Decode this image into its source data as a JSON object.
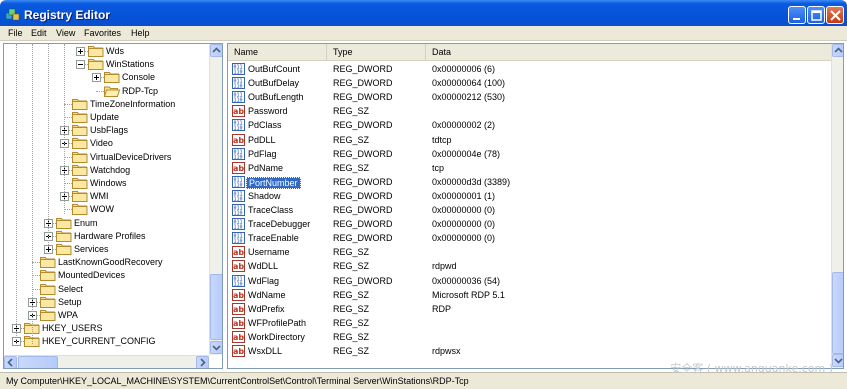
{
  "window": {
    "title": "Registry Editor"
  },
  "menu": [
    "File",
    "Edit",
    "View",
    "Favorites",
    "Help"
  ],
  "tree": [
    {
      "label": "Wds",
      "depth": 5,
      "expander": "plus"
    },
    {
      "label": "WinStations",
      "depth": 5,
      "expander": "minus"
    },
    {
      "label": "Console",
      "depth": 6,
      "expander": "plus"
    },
    {
      "label": "RDP-Tcp",
      "depth": 6,
      "expander": "none",
      "selected": true,
      "open_folder": true
    },
    {
      "label": "TimeZoneInformation",
      "depth": 4,
      "expander": "none"
    },
    {
      "label": "Update",
      "depth": 4,
      "expander": "none"
    },
    {
      "label": "UsbFlags",
      "depth": 4,
      "expander": "plus"
    },
    {
      "label": "Video",
      "depth": 4,
      "expander": "plus"
    },
    {
      "label": "VirtualDeviceDrivers",
      "depth": 4,
      "expander": "none"
    },
    {
      "label": "Watchdog",
      "depth": 4,
      "expander": "plus"
    },
    {
      "label": "Windows",
      "depth": 4,
      "expander": "none"
    },
    {
      "label": "WMI",
      "depth": 4,
      "expander": "plus"
    },
    {
      "label": "WOW",
      "depth": 4,
      "expander": "none"
    },
    {
      "label": "Enum",
      "depth": 3,
      "expander": "plus"
    },
    {
      "label": "Hardware Profiles",
      "depth": 3,
      "expander": "plus"
    },
    {
      "label": "Services",
      "depth": 3,
      "expander": "plus"
    },
    {
      "label": "LastKnownGoodRecovery",
      "depth": 2,
      "expander": "none"
    },
    {
      "label": "MountedDevices",
      "depth": 2,
      "expander": "none"
    },
    {
      "label": "Select",
      "depth": 2,
      "expander": "none"
    },
    {
      "label": "Setup",
      "depth": 2,
      "expander": "plus"
    },
    {
      "label": "WPA",
      "depth": 2,
      "expander": "plus"
    },
    {
      "label": "HKEY_USERS",
      "depth": 1,
      "expander": "plus"
    },
    {
      "label": "HKEY_CURRENT_CONFIG",
      "depth": 1,
      "expander": "plus"
    }
  ],
  "columns": {
    "name": "Name",
    "type": "Type",
    "data": "Data"
  },
  "values": [
    {
      "name": "OutBufCount",
      "type": "REG_DWORD",
      "data": "0x00000006 (6)",
      "icon": "dword"
    },
    {
      "name": "OutBufDelay",
      "type": "REG_DWORD",
      "data": "0x00000064 (100)",
      "icon": "dword"
    },
    {
      "name": "OutBufLength",
      "type": "REG_DWORD",
      "data": "0x00000212 (530)",
      "icon": "dword"
    },
    {
      "name": "Password",
      "type": "REG_SZ",
      "data": "",
      "icon": "string"
    },
    {
      "name": "PdClass",
      "type": "REG_DWORD",
      "data": "0x00000002 (2)",
      "icon": "dword"
    },
    {
      "name": "PdDLL",
      "type": "REG_SZ",
      "data": "tdtcp",
      "icon": "string"
    },
    {
      "name": "PdFlag",
      "type": "REG_DWORD",
      "data": "0x0000004e (78)",
      "icon": "dword"
    },
    {
      "name": "PdName",
      "type": "REG_SZ",
      "data": "tcp",
      "icon": "string"
    },
    {
      "name": "PortNumber",
      "type": "REG_DWORD",
      "data": "0x00000d3d (3389)",
      "icon": "dword",
      "selected": true
    },
    {
      "name": "Shadow",
      "type": "REG_DWORD",
      "data": "0x00000001 (1)",
      "icon": "dword"
    },
    {
      "name": "TraceClass",
      "type": "REG_DWORD",
      "data": "0x00000000 (0)",
      "icon": "dword"
    },
    {
      "name": "TraceDebugger",
      "type": "REG_DWORD",
      "data": "0x00000000 (0)",
      "icon": "dword"
    },
    {
      "name": "TraceEnable",
      "type": "REG_DWORD",
      "data": "0x00000000 (0)",
      "icon": "dword"
    },
    {
      "name": "Username",
      "type": "REG_SZ",
      "data": "",
      "icon": "string"
    },
    {
      "name": "WdDLL",
      "type": "REG_SZ",
      "data": "rdpwd",
      "icon": "string"
    },
    {
      "name": "WdFlag",
      "type": "REG_DWORD",
      "data": "0x00000036 (54)",
      "icon": "dword"
    },
    {
      "name": "WdName",
      "type": "REG_SZ",
      "data": "Microsoft RDP 5.1",
      "icon": "string"
    },
    {
      "name": "WdPrefix",
      "type": "REG_SZ",
      "data": "RDP",
      "icon": "string"
    },
    {
      "name": "WFProfilePath",
      "type": "REG_SZ",
      "data": "",
      "icon": "string"
    },
    {
      "name": "WorkDirectory",
      "type": "REG_SZ",
      "data": "",
      "icon": "string"
    },
    {
      "name": "WsxDLL",
      "type": "REG_SZ",
      "data": "rdpwsx",
      "icon": "string"
    }
  ],
  "status": {
    "path": "My Computer\\HKEY_LOCAL_MACHINE\\SYSTEM\\CurrentControlSet\\Control\\Terminal Server\\WinStations\\RDP-Tcp"
  },
  "watermark": "安全客 ( www.anquanke.com )",
  "colors": {
    "titlebar": "#0553d8",
    "selection": "#316ac5",
    "chrome": "#ece9d8"
  }
}
